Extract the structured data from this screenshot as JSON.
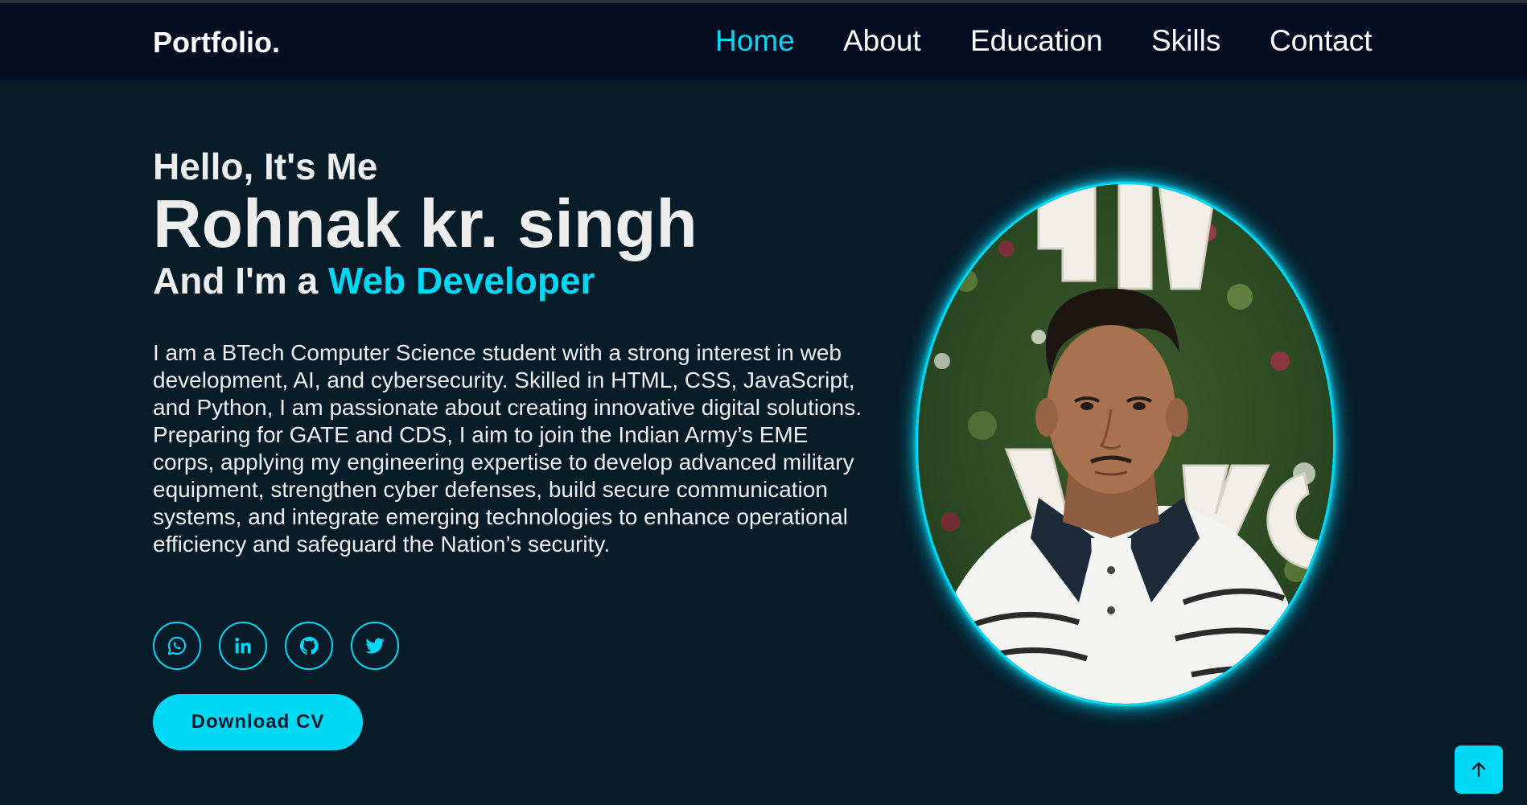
{
  "header": {
    "logo": "Portfolio.",
    "nav": [
      {
        "label": "Home",
        "active": true
      },
      {
        "label": "About",
        "active": false
      },
      {
        "label": "Education",
        "active": false
      },
      {
        "label": "Skills",
        "active": false
      },
      {
        "label": "Contact",
        "active": false
      }
    ]
  },
  "hero": {
    "greeting": "Hello, It's Me",
    "name": "Rohnak kr. singh",
    "role_prefix": "And I'm a ",
    "role": "Web Developer",
    "bio": "I am a BTech Computer Science student with a strong interest in web development, AI, and cybersecurity. Skilled in HTML, CSS, JavaScript, and Python, I am passionate about creating innovative digital solutions. Preparing for GATE and CDS, I aim to join the Indian Army’s EME corps, applying my engineering expertise to develop advanced military equipment, strengthen cyber defenses, build secure communication systems, and integrate emerging technologies to enhance operational efficiency and safeguard the Nation’s security.",
    "socials": [
      {
        "icon": "whatsapp-icon"
      },
      {
        "icon": "linkedin-icon"
      },
      {
        "icon": "github-icon"
      },
      {
        "icon": "twitter-icon"
      }
    ],
    "cv_button": "Download CV",
    "profile_photo": "profile-photo"
  },
  "scroll_top": {
    "icon": "arrow-up-icon"
  },
  "colors": {
    "accent": "#00d9f5",
    "background": "#081b29",
    "header_bg": "#050d22",
    "text": "#ededed"
  }
}
